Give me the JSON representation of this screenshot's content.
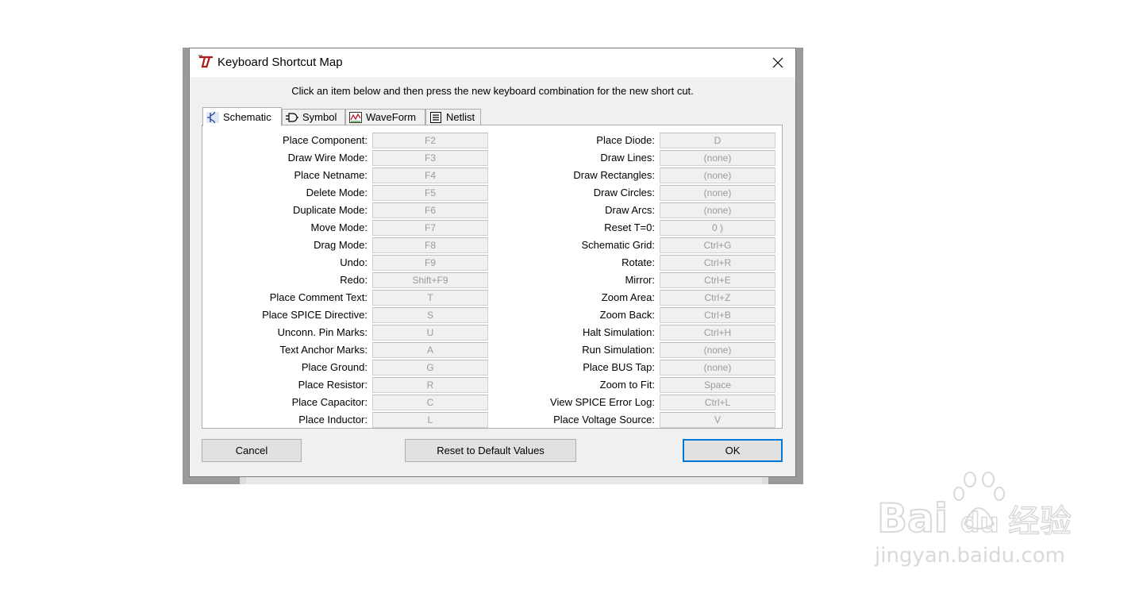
{
  "window": {
    "title": "Keyboard Shortcut Map"
  },
  "instruction": "Click an item below and then press the new keyboard combination for the new short cut.",
  "tabs": [
    {
      "label": "Schematic",
      "icon": "schematic-icon",
      "active": true
    },
    {
      "label": "Symbol",
      "icon": "symbol-icon",
      "active": false
    },
    {
      "label": "WaveForm",
      "icon": "waveform-icon",
      "active": false
    },
    {
      "label": "Netlist",
      "icon": "netlist-icon",
      "active": false
    }
  ],
  "shortcuts": {
    "left": [
      {
        "label": "Place Component:",
        "key": "F2"
      },
      {
        "label": "Draw Wire Mode:",
        "key": "F3"
      },
      {
        "label": "Place Netname:",
        "key": "F4"
      },
      {
        "label": "Delete Mode:",
        "key": "F5"
      },
      {
        "label": "Duplicate Mode:",
        "key": "F6"
      },
      {
        "label": "Move Mode:",
        "key": "F7"
      },
      {
        "label": "Drag Mode:",
        "key": "F8"
      },
      {
        "label": "Undo:",
        "key": "F9"
      },
      {
        "label": "Redo:",
        "key": "Shift+F9"
      },
      {
        "label": "Place Comment Text:",
        "key": "T"
      },
      {
        "label": "Place SPICE Directive:",
        "key": "S"
      },
      {
        "label": "Unconn. Pin Marks:",
        "key": "U"
      },
      {
        "label": "Text Anchor Marks:",
        "key": "A"
      },
      {
        "label": "Place Ground:",
        "key": "G"
      },
      {
        "label": "Place Resistor:",
        "key": "R"
      },
      {
        "label": "Place Capacitor:",
        "key": "C"
      },
      {
        "label": "Place Inductor:",
        "key": "L"
      }
    ],
    "right": [
      {
        "label": "Place Diode:",
        "key": "D"
      },
      {
        "label": "Draw Lines:",
        "key": "(none)"
      },
      {
        "label": "Draw Rectangles:",
        "key": "(none)"
      },
      {
        "label": "Draw Circles:",
        "key": "(none)"
      },
      {
        "label": "Draw Arcs:",
        "key": "(none)"
      },
      {
        "label": "Reset T=0:",
        "key": "0 )"
      },
      {
        "label": "Schematic Grid:",
        "key": "Ctrl+G"
      },
      {
        "label": "Rotate:",
        "key": "Ctrl+R"
      },
      {
        "label": "Mirror:",
        "key": "Ctrl+E"
      },
      {
        "label": "Zoom Area:",
        "key": "Ctrl+Z"
      },
      {
        "label": "Zoom Back:",
        "key": "Ctrl+B"
      },
      {
        "label": "Halt Simulation:",
        "key": "Ctrl+H"
      },
      {
        "label": "Run Simulation:",
        "key": "(none)"
      },
      {
        "label": "Place BUS Tap:",
        "key": "(none)"
      },
      {
        "label": "Zoom to Fit:",
        "key": "Space"
      },
      {
        "label": "View SPICE Error Log:",
        "key": "Ctrl+L"
      },
      {
        "label": "Place Voltage Source:",
        "key": "V"
      }
    ]
  },
  "buttons": {
    "cancel": "Cancel",
    "reset": "Reset to Default Values",
    "ok": "OK"
  },
  "watermark": {
    "brand_text": "Bai du 经验",
    "url_text": "jingyan.baidu.com"
  },
  "colors": {
    "default_button_border": "#0078d7",
    "key_text": "#9a9a9a",
    "dialog_bg": "#f0f0f0"
  }
}
